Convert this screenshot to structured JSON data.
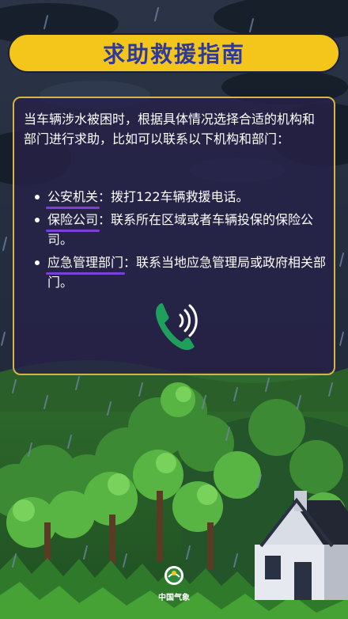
{
  "title": "求助救援指南",
  "intro": "当车辆涉水被困时，根据具体情况选择合适的机构和部门进行求助，比如可以联系以下机构和部门：",
  "items": [
    {
      "term": "公安机关",
      "desc": "：拨打122车辆救援电话。"
    },
    {
      "term": "保险公司",
      "desc": "：联系所在区域或者车辆投保的保险公司。"
    },
    {
      "term": "应急管理部门",
      "desc": "：联系当地应急管理局或政府相关部门。"
    }
  ],
  "logo_text": "中国气象",
  "icons": {
    "phone": "phone-call-icon",
    "logo": "china-weather-logo-icon"
  },
  "colors": {
    "banner": "#f4c51b",
    "title_text": "#2d3a9c",
    "card_border": "#d5b547",
    "underline": "#7a3fd6",
    "phone": "#1f9e5c"
  }
}
